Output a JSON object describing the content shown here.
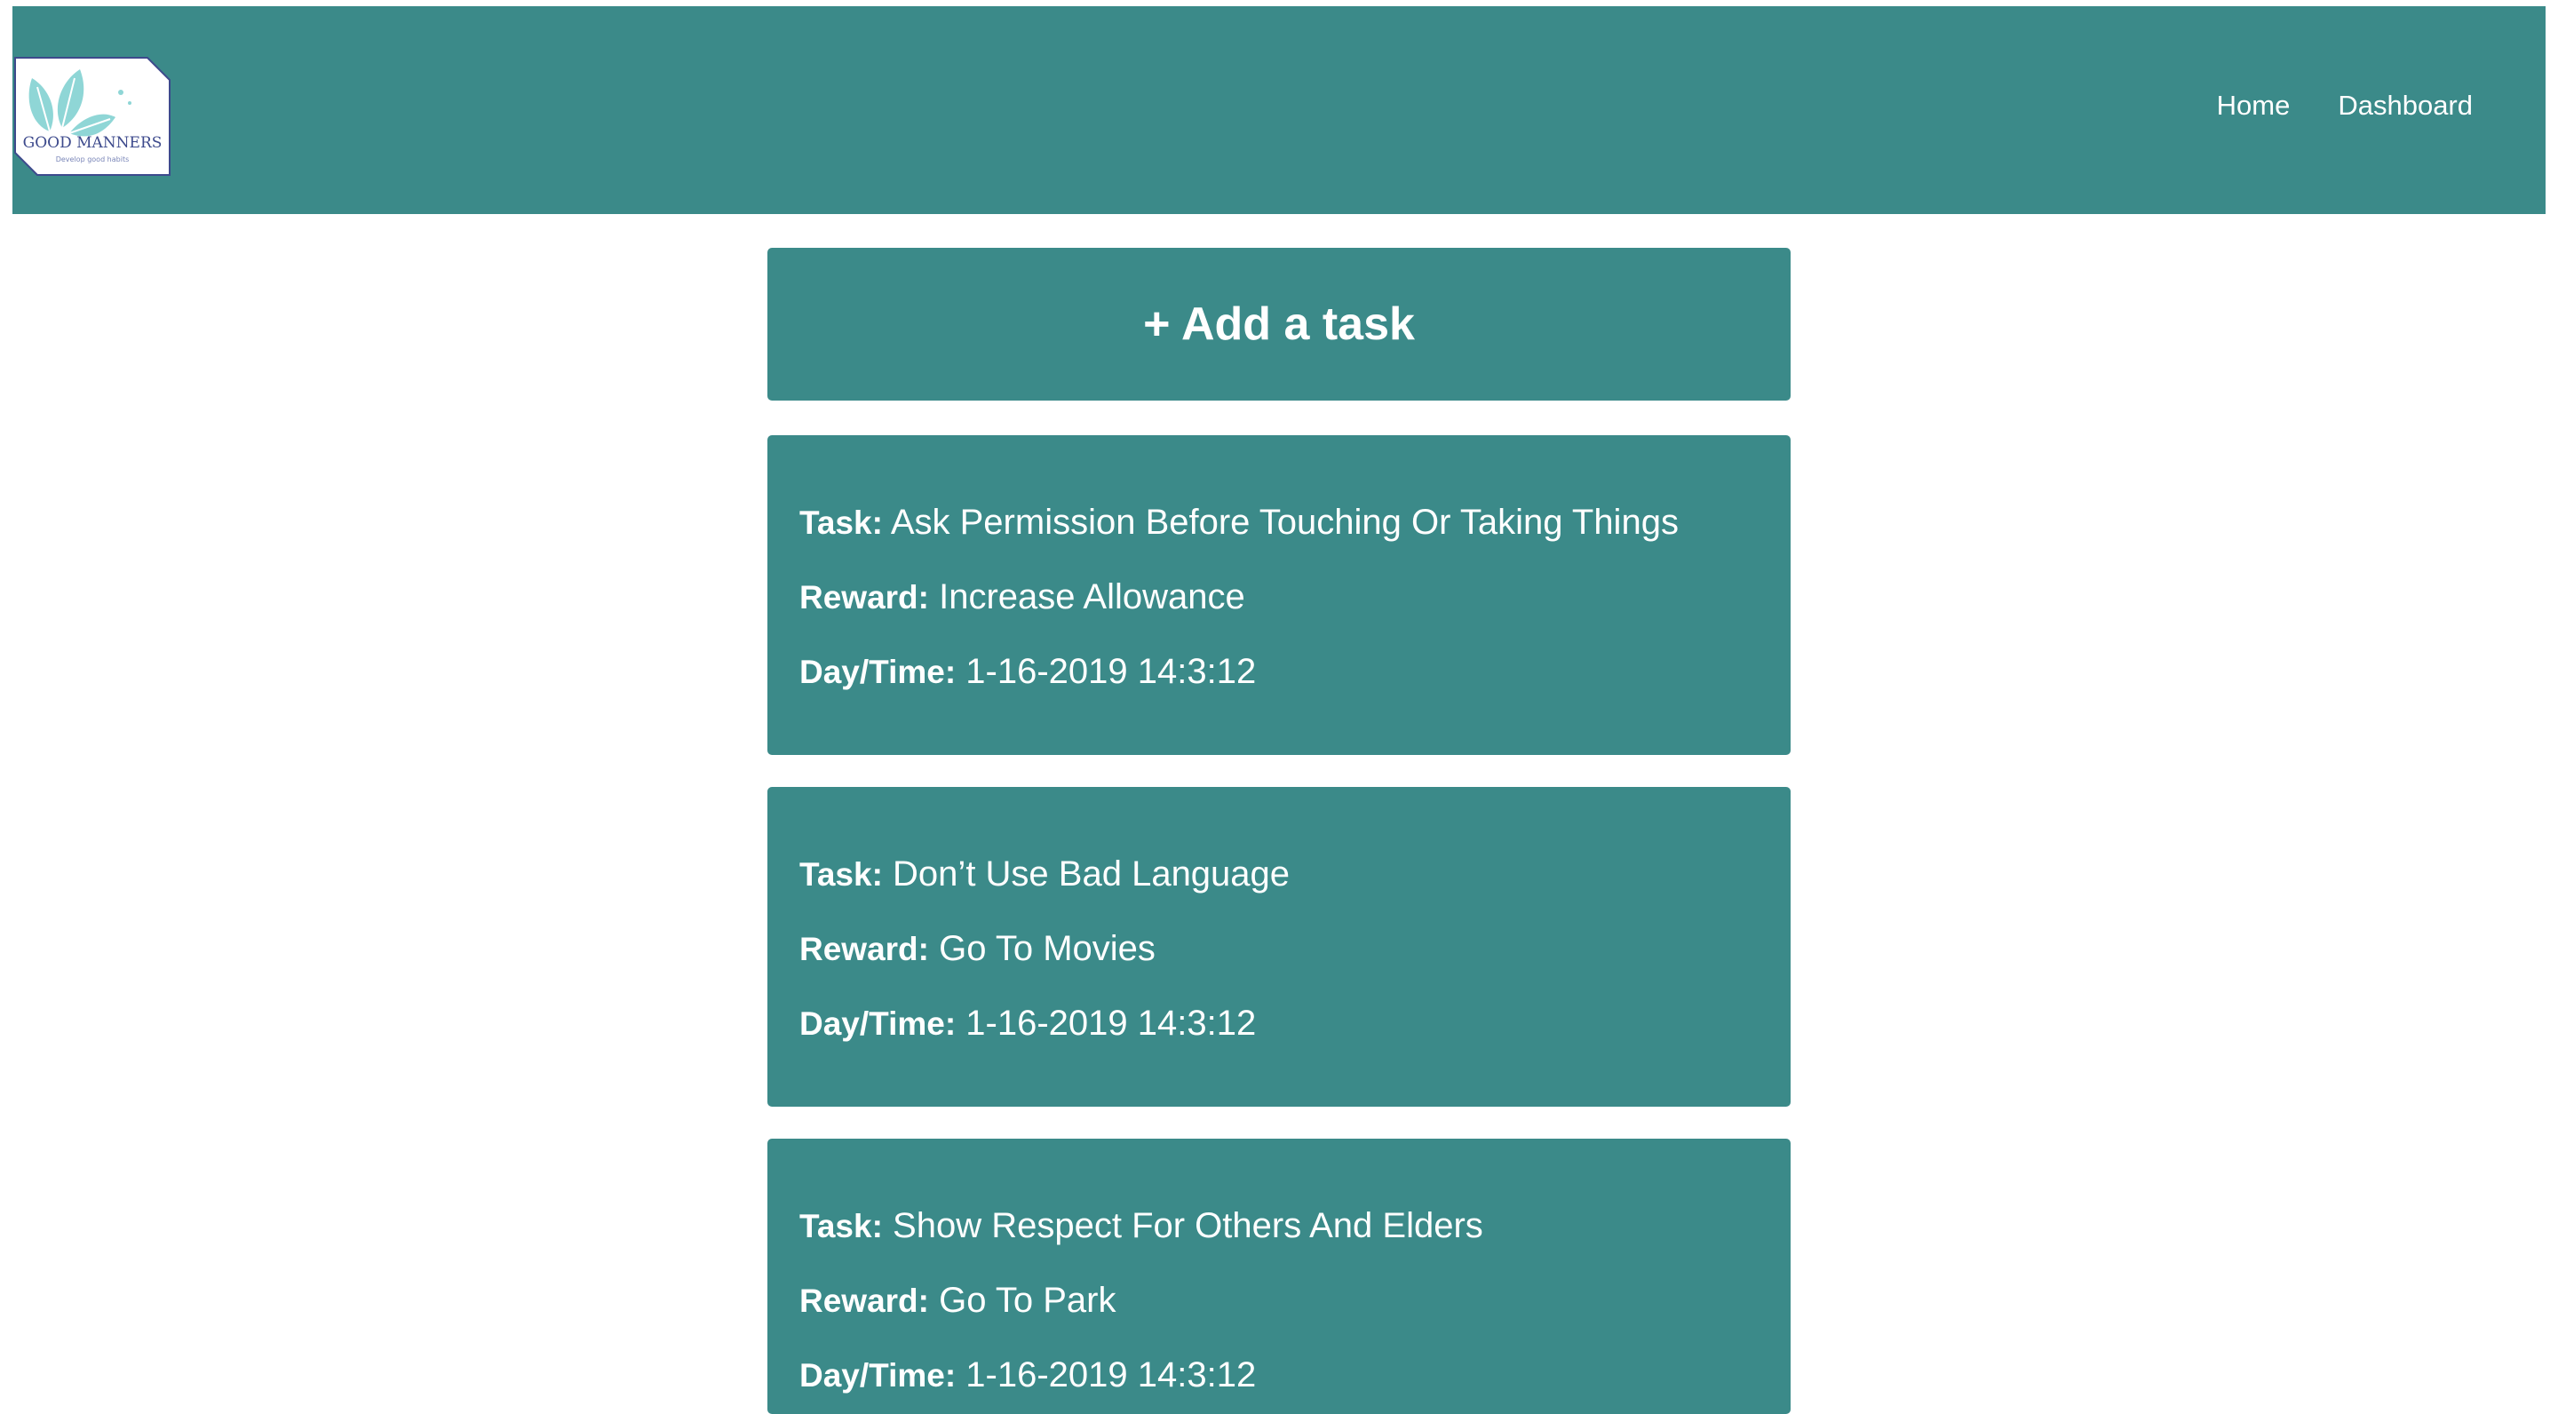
{
  "brand": {
    "logo_title": "GOOD MANNERS",
    "logo_tagline": "Develop good habits"
  },
  "nav": {
    "home": "Home",
    "dashboard": "Dashboard"
  },
  "add_task_label": "+ Add a task",
  "labels": {
    "task": "Task:",
    "reward": "Reward:",
    "daytime": "Day/Time:"
  },
  "tasks": [
    {
      "task": "Ask Permission Before Touching Or Taking Things",
      "reward": "Increase Allowance",
      "daytime": "1-16-2019 14:3:12"
    },
    {
      "task": "Don’t Use Bad Language",
      "reward": "Go To Movies",
      "daytime": "1-16-2019 14:3:12"
    },
    {
      "task": "Show Respect For Others And Elders",
      "reward": "Go To Park",
      "daytime": "1-16-2019 14:3:12"
    }
  ],
  "colors": {
    "primary": "#3b8a89",
    "text_on_primary": "#ffffff",
    "logo_leaf": "#8fd6d6",
    "logo_text": "#3d4a8c"
  }
}
